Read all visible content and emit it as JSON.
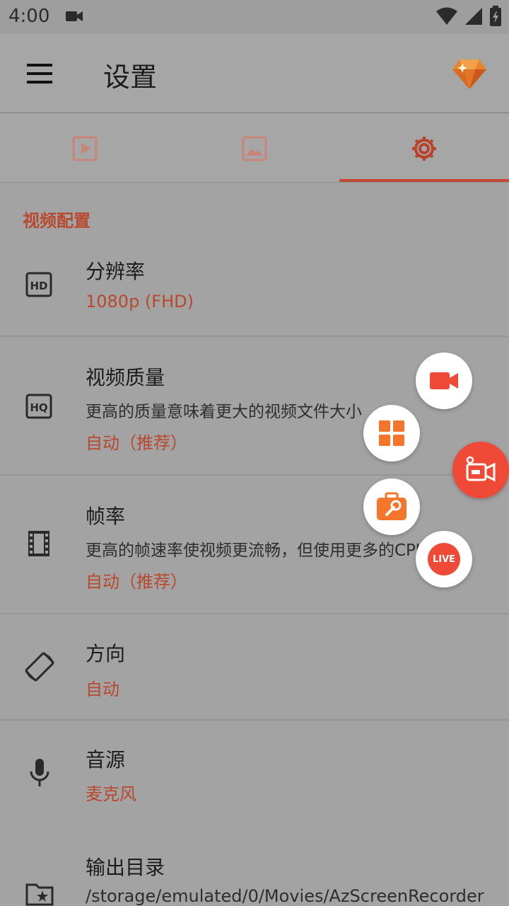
{
  "status_bar": {
    "time": "4:00"
  },
  "app_bar": {
    "title": "设置"
  },
  "tabs": [
    {
      "name": "videos",
      "icon": "play-box-icon"
    },
    {
      "name": "images",
      "icon": "image-icon"
    },
    {
      "name": "settings",
      "icon": "gear-icon",
      "selected": true
    }
  ],
  "section": {
    "title": "视频配置"
  },
  "settings": [
    {
      "label": "分辨率",
      "value": "1080p (FHD)",
      "icon": "hd-icon"
    },
    {
      "label": "视频质量",
      "desc": "更高的质量意味着更大的视频文件大小",
      "value": "自动（推荐）",
      "icon": "hq-icon"
    },
    {
      "label": "帧率",
      "desc": "更高的帧速率使视频更流畅，但使用更多的CPU",
      "value": "自动（推荐）",
      "icon": "film-icon"
    },
    {
      "label": "方向",
      "value": "自动",
      "icon": "screen-rotation-icon"
    },
    {
      "label": "音源",
      "value": "麦克风",
      "icon": "microphone-icon"
    },
    {
      "label": "输出目录",
      "value": "/storage/emulated/0/Movies/AzScreenRecorder",
      "icon": "folder-star-icon"
    }
  ],
  "floating_menu": {
    "live_label": "LIVE",
    "colors": {
      "record": "#ef4a37",
      "tools": "#f4762c",
      "accent": "#b8482e"
    }
  }
}
